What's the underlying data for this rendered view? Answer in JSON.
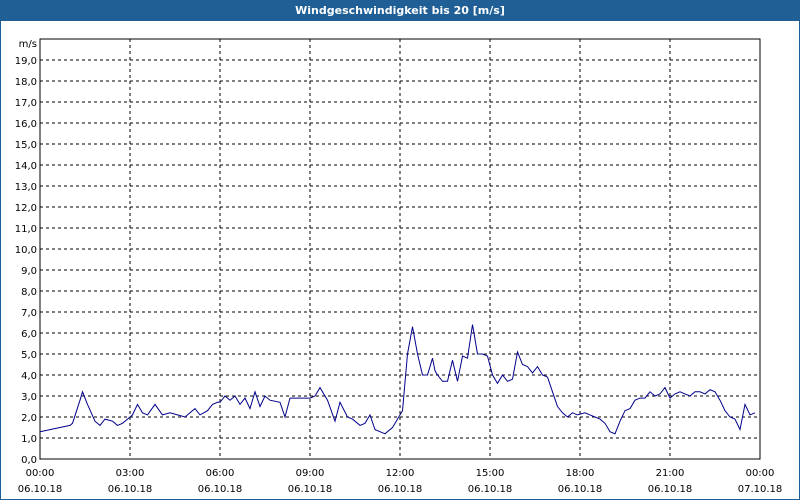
{
  "window": {
    "title": "Windgeschwindigkeit bis 20 [m/s]"
  },
  "colors": {
    "titlebar": "#1f5f96",
    "line": "#00008b",
    "grid": "#000000"
  },
  "chart_data": {
    "type": "line",
    "title": "Windgeschwindigkeit bis 20 [m/s]",
    "ylabel": "m/s",
    "ylim": [
      0,
      20
    ],
    "xlim_hours": [
      0,
      24
    ],
    "grid": true,
    "y_ticks": [
      "0,0",
      "1,0",
      "2,0",
      "3,0",
      "4,0",
      "5,0",
      "6,0",
      "7,0",
      "8,0",
      "9,0",
      "10,0",
      "11,0",
      "12,0",
      "13,0",
      "14,0",
      "15,0",
      "16,0",
      "17,0",
      "18,0",
      "19,0"
    ],
    "x_ticks": [
      {
        "time": "00:00",
        "date": "06.10.18"
      },
      {
        "time": "03:00",
        "date": "06.10.18"
      },
      {
        "time": "06:00",
        "date": "06.10.18"
      },
      {
        "time": "09:00",
        "date": "06.10.18"
      },
      {
        "time": "12:00",
        "date": "06.10.18"
      },
      {
        "time": "15:00",
        "date": "06.10.18"
      },
      {
        "time": "18:00",
        "date": "06.10.18"
      },
      {
        "time": "21:00",
        "date": "06.10.18"
      },
      {
        "time": "00:00",
        "date": "07.10.18"
      }
    ],
    "series": [
      {
        "x": [
          "00:00",
          "00:20",
          "00:40",
          "01:00",
          "01:05",
          "01:20",
          "01:25",
          "01:35",
          "01:50",
          "02:00",
          "02:10",
          "02:25",
          "02:35",
          "02:45",
          "02:55",
          "03:05",
          "03:15",
          "03:25",
          "03:35",
          "03:50",
          "04:05",
          "04:20",
          "04:35",
          "04:50",
          "05:00",
          "05:10",
          "05:20",
          "05:35",
          "05:45",
          "05:55",
          "06:00",
          "06:10",
          "06:20",
          "06:30",
          "06:40",
          "06:50",
          "07:00",
          "07:10",
          "07:20",
          "07:30",
          "07:40",
          "08:00",
          "08:10",
          "08:20",
          "08:40",
          "09:00",
          "09:10",
          "09:20",
          "09:35",
          "09:50",
          "10:00",
          "10:15",
          "10:25",
          "10:40",
          "10:50",
          "11:00",
          "11:10",
          "11:20",
          "11:30",
          "11:45",
          "11:55",
          "12:05",
          "12:15",
          "12:25",
          "12:35",
          "12:45",
          "12:55",
          "13:05",
          "13:10",
          "13:15",
          "13:25",
          "13:35",
          "13:45",
          "13:55",
          "14:05",
          "14:15",
          "14:25",
          "14:35",
          "14:45",
          "14:55",
          "15:05",
          "15:15",
          "15:25",
          "15:35",
          "15:45",
          "15:55",
          "16:05",
          "16:15",
          "16:25",
          "16:35",
          "16:45",
          "16:55",
          "17:05",
          "17:15",
          "17:25",
          "17:35",
          "17:45",
          "17:55",
          "18:10",
          "18:20",
          "18:30",
          "18:40",
          "18:50",
          "19:00",
          "19:10",
          "19:20",
          "19:30",
          "19:40",
          "19:50",
          "20:00",
          "20:10",
          "20:20",
          "20:30",
          "20:40",
          "20:50",
          "21:00",
          "21:10",
          "21:20",
          "21:30",
          "21:40",
          "21:50",
          "22:00",
          "22:10",
          "22:20",
          "22:30",
          "22:40",
          "22:50",
          "23:00",
          "23:10",
          "23:20",
          "23:30",
          "23:40",
          "23:50"
        ],
        "y": [
          1.3,
          1.4,
          1.5,
          1.6,
          1.7,
          2.8,
          3.2,
          2.6,
          1.8,
          1.6,
          1.9,
          1.8,
          1.6,
          1.7,
          1.9,
          2.1,
          2.6,
          2.2,
          2.1,
          2.6,
          2.1,
          2.2,
          2.1,
          2.0,
          2.2,
          2.4,
          2.1,
          2.3,
          2.6,
          2.7,
          2.7,
          3.0,
          2.8,
          3.0,
          2.6,
          2.9,
          2.4,
          3.2,
          2.5,
          3.0,
          2.8,
          2.7,
          2.0,
          2.9,
          2.9,
          2.9,
          3.0,
          3.4,
          2.8,
          1.8,
          2.7,
          2.0,
          1.9,
          1.6,
          1.7,
          2.1,
          1.4,
          1.3,
          1.2,
          1.5,
          1.9,
          2.3,
          5.0,
          6.3,
          5.0,
          4.0,
          4.0,
          4.8,
          4.2,
          4.0,
          3.7,
          3.7,
          4.7,
          3.7,
          4.9,
          4.8,
          6.4,
          5.0,
          5.0,
          4.9,
          4.0,
          3.6,
          4.0,
          3.7,
          3.8,
          5.1,
          4.5,
          4.4,
          4.1,
          4.4,
          4.0,
          3.9,
          3.2,
          2.5,
          2.2,
          2.0,
          2.2,
          2.1,
          2.2,
          2.1,
          2.0,
          1.9,
          1.7,
          1.3,
          1.2,
          1.8,
          2.3,
          2.4,
          2.8,
          2.9,
          2.9,
          3.2,
          3.0,
          3.1,
          3.4,
          2.9,
          3.1,
          3.2,
          3.1,
          3.0,
          3.2,
          3.2,
          3.1,
          3.3,
          3.2,
          2.8,
          2.3,
          2.0,
          1.9,
          1.4,
          2.6,
          2.1,
          2.2
        ]
      }
    ]
  }
}
